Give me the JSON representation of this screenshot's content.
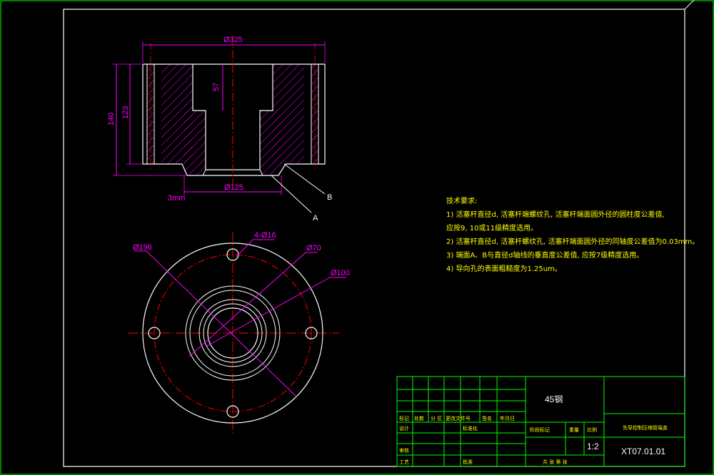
{
  "colors": {
    "background": "#000000",
    "frame": "#ffffff",
    "outline": "#ffffff",
    "hatch": "#ff00ff",
    "dimension": "#ff00ff",
    "centerline": "#ff0000",
    "titleblock": "#00ff00",
    "note": "#ffff00"
  },
  "section_view": {
    "dims": {
      "d325": "Ø325",
      "h57": "57",
      "h140": "140",
      "h123": "123",
      "d125": "Ø125",
      "label_a": "A",
      "label_b": "B",
      "small_tag": "3mm"
    }
  },
  "plan_view": {
    "dims": {
      "d196": "Ø196",
      "holes": "4-Ø16",
      "d70": "Ø70",
      "d100": "Ø100"
    }
  },
  "notes": {
    "title": "技术要求:",
    "lines": [
      "1) 活塞杆直径d, 活塞杆端螺纹孔, 活塞杆端面圆外径的圆柱度公差值,",
      "   应按9, 10或11级精度选用。",
      "2) 活塞杆直径d, 活塞杆螺纹孔, 活塞杆端面圆外径的同轴度公差值为0.03mm。",
      "3) 端面A、B与直径d轴线的垂直度公差值, 应按7级精度选用。",
      "4) 导向孔的表面粗糙度为1.25um。"
    ]
  },
  "title_block": {
    "material": "45钢",
    "part_name": "先导控制压缩管端盖",
    "drawing_no": "XT07.01.01",
    "scale": "1:2",
    "rev_headers": [
      "标记",
      "处数",
      "分 区",
      "更改文件号",
      "签名",
      "年月日"
    ],
    "sign_rows": [
      "设计",
      "标准化",
      "审核",
      "工艺",
      "批准"
    ],
    "mid_headers": [
      "阶段标记",
      "重量",
      "比例"
    ],
    "sheet_footer": "共 张  第 张"
  }
}
